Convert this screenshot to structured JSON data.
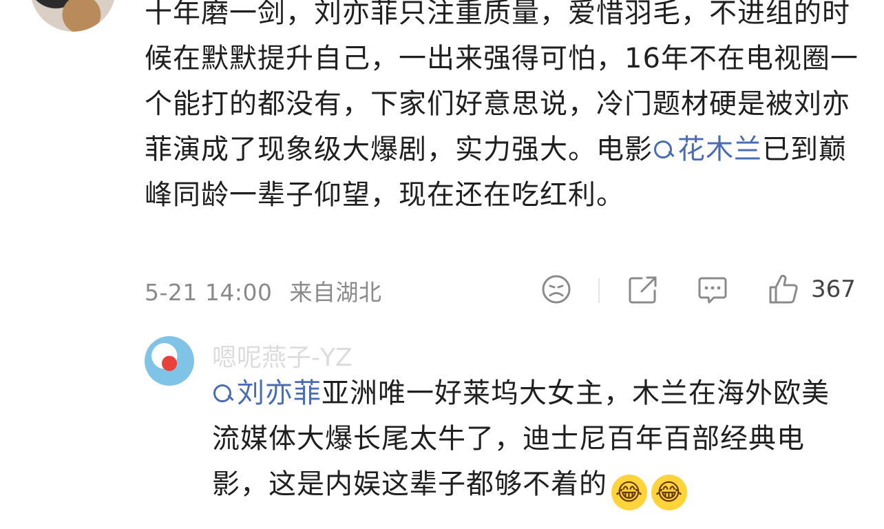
{
  "comment": {
    "text_before_topic": "十年磨一剑，刘亦菲只注重质量，爱惜羽毛，不进组的时候在默默提升自己，一出来强得可怕，16年不在电视圈一个能打的都没有，下家们好意思说，冷门题材硬是被刘亦菲演成了现象级大爆剧，实力强大。电影",
    "topic": "花木兰",
    "text_after_topic": "已到巅峰同龄一辈子仰望，现在还在吃红利。",
    "date": "5-21 14:00",
    "location": "来自湖北",
    "like_count": "367"
  },
  "reply": {
    "username": "嗯呢燕子-YZ",
    "topic": "刘亦菲",
    "text": "亚洲唯一好莱坞大女主，木兰在海外欧美流媒体大爆长尾太牛了，迪士尼百年百部经典电影，这是内娱这辈子都够不着的",
    "emojis": [
      "😂",
      "😂"
    ]
  },
  "icons": {
    "dislike": "sad-face-icon",
    "share": "share-icon",
    "comment": "comment-icon",
    "like": "thumbs-up-icon",
    "topic": "search-icon"
  }
}
